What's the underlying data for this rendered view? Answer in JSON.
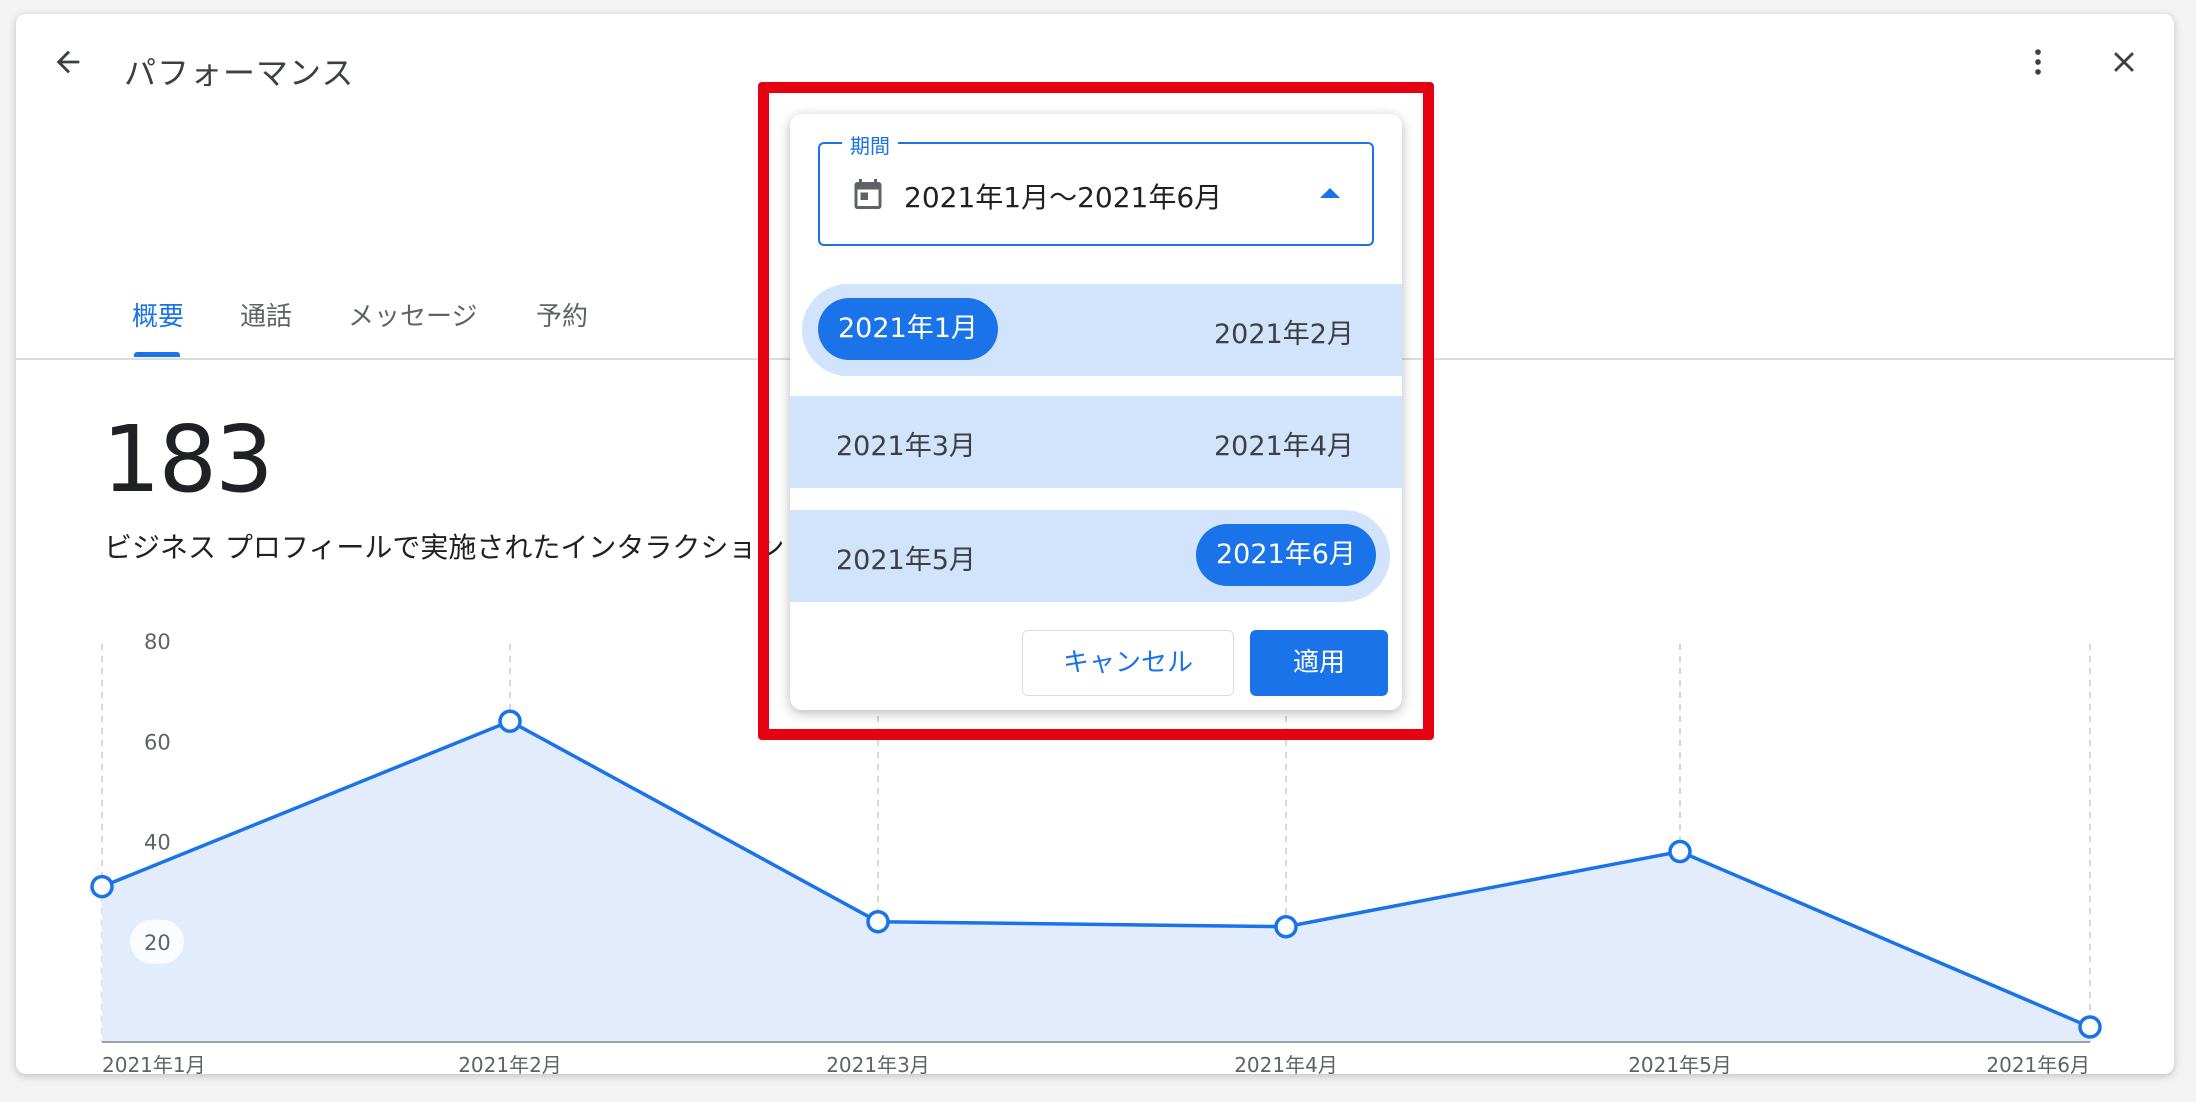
{
  "header": {
    "title": "パフォーマンス",
    "back_icon": "arrow-back-icon",
    "more_icon": "more-vert-icon",
    "close_icon": "close-icon"
  },
  "tabs": [
    {
      "label": "概要",
      "active": true
    },
    {
      "label": "通話",
      "active": false
    },
    {
      "label": "メッセージ",
      "active": false
    },
    {
      "label": "予約",
      "active": false
    }
  ],
  "summary": {
    "value": "183",
    "label": "ビジネス プロフィールで実施されたインタラクション"
  },
  "date_picker": {
    "legend": "期間",
    "value": "2021年1月〜2021年6月",
    "months": [
      {
        "label": "2021年1月",
        "selected": true
      },
      {
        "label": "2021年2月",
        "selected": false
      },
      {
        "label": "2021年3月",
        "selected": false
      },
      {
        "label": "2021年4月",
        "selected": false
      },
      {
        "label": "2021年5月",
        "selected": false
      },
      {
        "label": "2021年6月",
        "selected": true
      }
    ],
    "cancel_label": "キャンセル",
    "apply_label": "適用"
  },
  "colors": {
    "accent": "#1a73e8",
    "range_fill": "#d2e3fc",
    "highlight": "#e50012",
    "area_fill": "#e3ecfc"
  },
  "chart_data": {
    "type": "area",
    "categories": [
      "2021年1月",
      "2021年2月",
      "2021年3月",
      "2021年4月",
      "2021年5月",
      "2021年6月"
    ],
    "values": [
      31,
      64,
      24,
      23,
      38,
      3
    ],
    "yticks": [
      "20",
      "40",
      "60",
      "80"
    ],
    "ylim": [
      0,
      80
    ],
    "grid": "vertical dashed"
  }
}
